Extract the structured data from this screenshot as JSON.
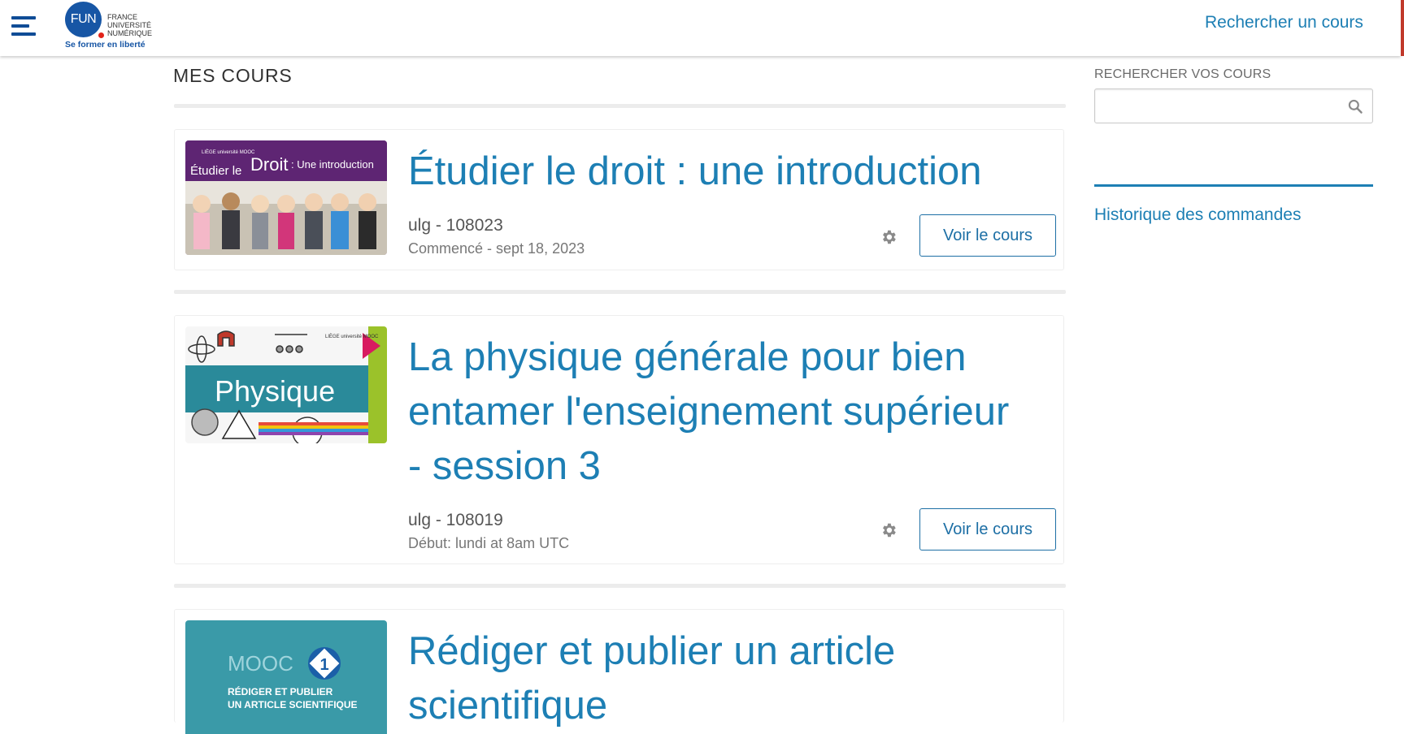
{
  "header": {
    "logo": {
      "mark": "FUN",
      "lines": [
        "FRANCE",
        "UNIVERSITÉ",
        "NUMÉRIQUE"
      ],
      "tagline": "Se former en liberté"
    },
    "search_link": "Rechercher un cours",
    "colors": {
      "brand": "#1756a5",
      "accent_red": "#e2231a",
      "link": "#1d7fb4"
    }
  },
  "main": {
    "title": "MES COURS",
    "courses": [
      {
        "title": "Étudier le droit : une introduction",
        "org": "ulg - 108023",
        "date": "Commencé - sept 18, 2023",
        "button": "Voir le cours",
        "thumbnail": {
          "logo_small": "LIÈGE université MOOC",
          "text_a": "Étudier le ",
          "text_b": "Droit",
          "text_c": ": Une introduction"
        }
      },
      {
        "title": "La physique générale pour bien entamer l'enseignement supérieur - session 3",
        "org": "ulg - 108019",
        "date": "Début: lundi at 8am UTC",
        "button": "Voir le cours",
        "thumbnail": {
          "logo_small": "LIÈGE université MOOC",
          "text": "Physique"
        }
      },
      {
        "title": "Rédiger et publier un article scientifique",
        "thumbnail": {
          "badge": "MOOC",
          "number": "1",
          "line1": "RÉDIGER ET PUBLIER",
          "line2": "UN ARTICLE SCIENTIFIQUE"
        }
      }
    ]
  },
  "sidebar": {
    "search_label": "RECHERCHER VOS COURS",
    "search_placeholder": "",
    "link": "Historique des commandes"
  }
}
